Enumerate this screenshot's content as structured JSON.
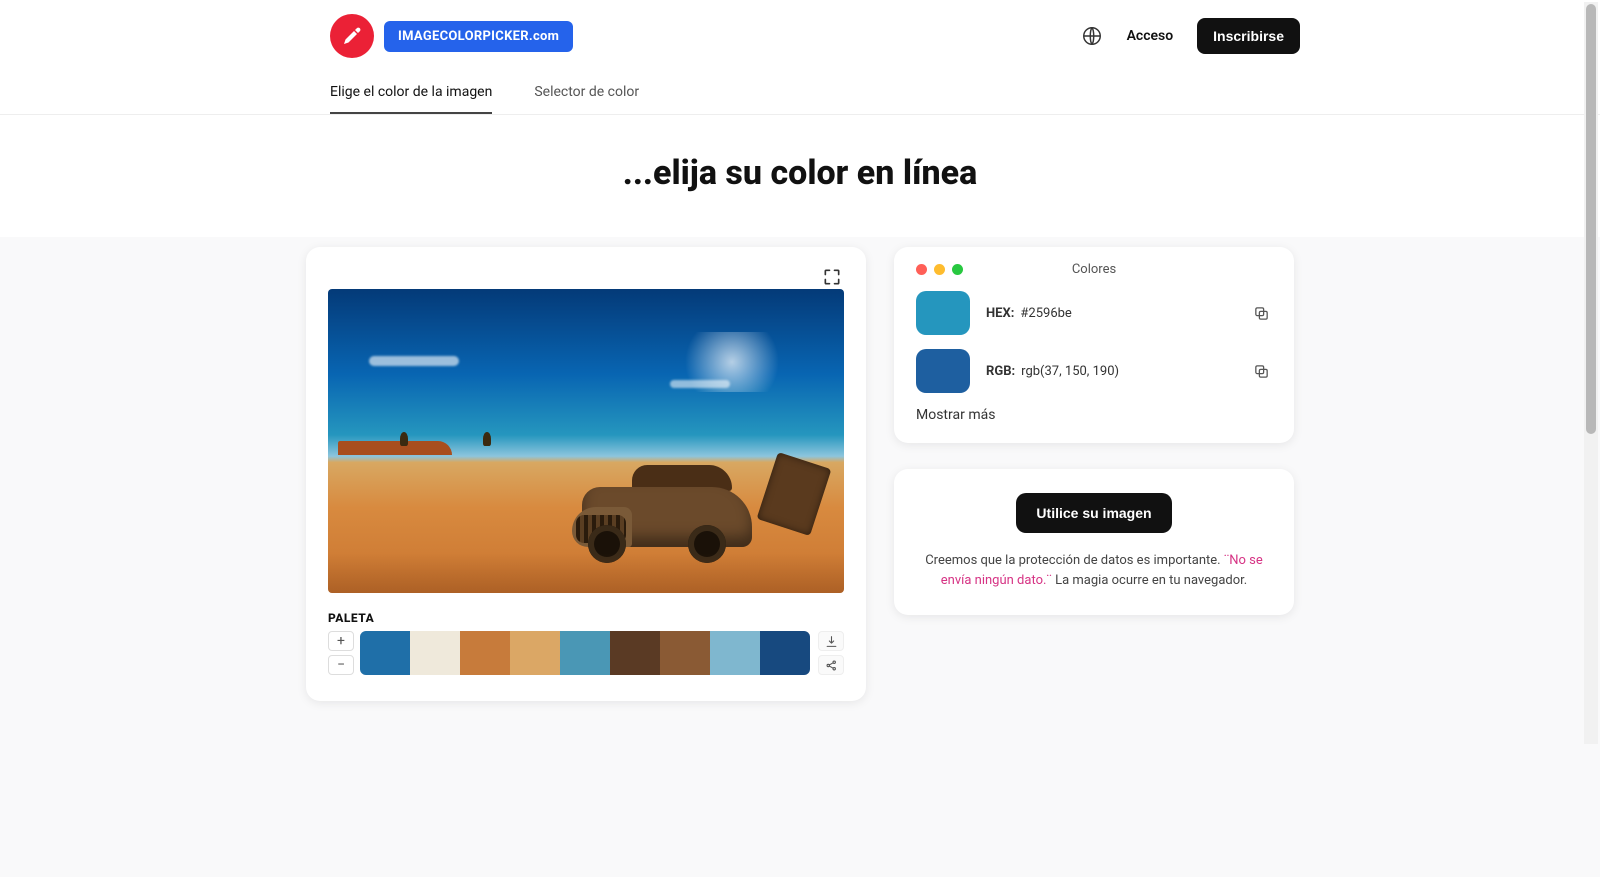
{
  "header": {
    "brand": "IMAGECOLORPICKER.com",
    "login": "Acceso",
    "signup": "Inscribirse"
  },
  "tabs": {
    "pick": "Elige el color de la imagen",
    "selector": "Selector de color"
  },
  "hero": "...elija su color en línea",
  "palette": {
    "title": "PALETA",
    "colors": [
      "#1f6fa8",
      "#efe9db",
      "#c77b3b",
      "#dba765",
      "#4a97b5",
      "#5a3a24",
      "#8a5a34",
      "#7fb7cf",
      "#17497f"
    ]
  },
  "colors_card": {
    "title": "Colores",
    "hex_label": "HEX:",
    "hex_value": "#2596be",
    "hex_chip": "#2596be",
    "rgb_label": "RGB:",
    "rgb_value": "rgb(37, 150, 190)",
    "rgb_chip": "#1e5fa0",
    "show_more": "Mostrar más"
  },
  "upload": {
    "button": "Utilice su imagen",
    "text_before": "Creemos que la protección de datos es importante. ",
    "highlight": "¨No se envía ningún dato.¨",
    "text_after": " La magia ocurre en tu navegador."
  }
}
